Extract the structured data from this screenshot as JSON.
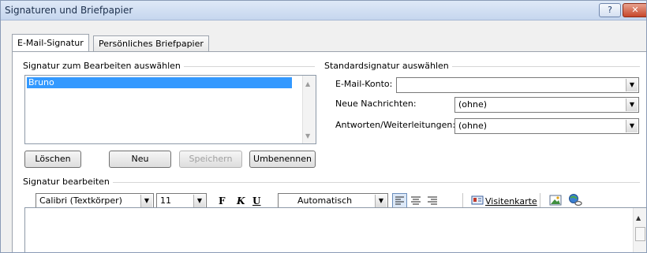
{
  "window": {
    "title": "Signaturen und Briefpapier",
    "help_label": "?",
    "close_label": "✕"
  },
  "tabs": [
    {
      "label": "E-Mail-Signatur",
      "active": true
    },
    {
      "label": "Persönliches Briefpapier",
      "active": false
    }
  ],
  "select_signature": {
    "title": "Signatur zum Bearbeiten auswählen",
    "items": [
      "Bruno"
    ],
    "selected": "Bruno"
  },
  "buttons": {
    "delete": "Löschen",
    "new": "Neu",
    "save": "Speichern",
    "rename": "Umbenennen"
  },
  "default_signature": {
    "title": "Standardsignatur auswählen",
    "account_label": "E-Mail-Konto:",
    "account_value": "",
    "new_messages_label": "Neue Nachrichten:",
    "new_messages_value": "(ohne)",
    "replies_label": "Antworten/Weiterleitungen:",
    "replies_value": "(ohne)"
  },
  "edit_signature": {
    "title": "Signatur bearbeiten",
    "font": "Calibri (Textkörper)",
    "size": "11",
    "bold_label": "F",
    "italic_label": "K",
    "underline_label": "U",
    "color": "Automatisch",
    "business_card_label": "Visitenkarte"
  },
  "icons": {
    "align_left": "align-left-icon",
    "align_center": "align-center-icon",
    "align_right": "align-right-icon",
    "business_card": "business-card-icon",
    "picture": "insert-picture-icon",
    "hyperlink": "insert-hyperlink-icon"
  },
  "colors": {
    "selection": "#3399ff",
    "title_bar": "#c5d6ee",
    "close_button": "#c7472b"
  }
}
